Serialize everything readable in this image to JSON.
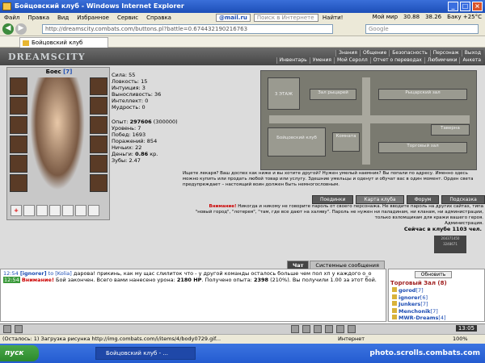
{
  "window": {
    "title": "Бойцовский клуб - Windows Internet Explorer"
  },
  "menu": {
    "items": [
      "Файл",
      "Правка",
      "Вид",
      "Избранное",
      "Сервис",
      "Справка"
    ],
    "mailru": "@mail.ru",
    "search_placeholder": "Поиск в Интернете",
    "find": "Найти!",
    "moi_mir": "Мой мир",
    "stock1": "30.88",
    "stock2": "38.26",
    "weather": "Баку +25°C"
  },
  "address": {
    "url": "http://dreamscity.combats.com/buttons.pl?battle=0.674432190216763",
    "search_placeholder": "Google"
  },
  "tab": {
    "label": "Бойцовский клуб"
  },
  "game": {
    "logo": "DREAMSCITY",
    "nav_top": [
      "Знания",
      "Общение",
      "Безопасность",
      "Персонаж",
      "Выход"
    ],
    "nav_bottom": [
      "Инвентарь",
      "Умения",
      "Мой Серолл",
      "Отчет о переводах",
      "Любимчики",
      "Анкета"
    ],
    "char": {
      "name": "Боес",
      "level": "[7]"
    },
    "stats": [
      {
        "label": "Сила:",
        "value": "55"
      },
      {
        "label": "Ловкость:",
        "value": "15"
      },
      {
        "label": "Интуиция:",
        "value": "3"
      },
      {
        "label": "Выносливость:",
        "value": "36"
      },
      {
        "label": "Интеллект:",
        "value": "0"
      },
      {
        "label": "Мудрость:",
        "value": "0"
      }
    ],
    "exp": {
      "label": "Опыт:",
      "value": "297606",
      "extra": "(300000)"
    },
    "level": {
      "label": "Уровень:",
      "value": "7"
    },
    "wins": {
      "label": "Побед:",
      "value": "1693"
    },
    "losses": {
      "label": "Поражений:",
      "value": "854"
    },
    "draws": {
      "label": "Ничьих:",
      "value": "22"
    },
    "money": {
      "label": "Деньги:",
      "value": "0.86",
      "unit": "кр."
    },
    "teeth": {
      "label": "Зубы:",
      "value": "2.47"
    },
    "map": {
      "floor": "3 ЭТАЖ",
      "halls": [
        "Зал рыцарей",
        "Рыцарский зал",
        "Торговый зал",
        "Комната",
        "Бойцовский клуб",
        "Таверна"
      ]
    },
    "msg": "Ищете лекаря? Ваш доспех как ниже и вы хотите другой? Нужен умелый наемник? Вы попали по адресу. Именно здесь можно купить или продать любой товар или услугу. Здешние умельцы и оденут и обучат вас в один момент. Орден света предупреждает – настоящий воин должен быть немногословным.",
    "buttons": [
      "Поединки",
      "Карта клуба",
      "Форум",
      "Подсказка"
    ],
    "warning": {
      "lead": "Внимание!",
      "text": "Никогда и никому не говорите пароль от своего персонажа. Не вводите пароль на других сайтах, типа \"новый город\", \"лотерея\", \"там, где все дают на халяву\". Пароль не нужен ни паладинам, ни кланам, ни администрации, только взломщикам для кражи вашего героя.",
      "sign": "Администрация."
    },
    "online": "Сейчас в клубе 1103 чел.",
    "counter": "264371450 \n 3248671",
    "chat_tabs": [
      "Чат",
      "Системные сообщения"
    ],
    "chat": {
      "line1": {
        "time": "12:54",
        "nick": "[ignorer]",
        "to": "to [Kolia]",
        "text": "дарова! прикинь, как му щас слилиток что - у другой команды осталось больше чем пол хп у каждого о_о"
      },
      "line2": {
        "time": "12:54",
        "lead": "Внимание!",
        "text": "Бой закончен. Всего вами нанесено урона:",
        "dmg": "2180 HP",
        "text2": ". Получено опыта:",
        "exp": "2398",
        "text3": "(210%). Вы получили",
        "money": "1.00",
        "text4": "за этот бой."
      }
    },
    "users": {
      "refresh": "Обновить",
      "room": "Торговый Зал (8)",
      "list": [
        {
          "name": "gorod",
          "lvl": "[7]"
        },
        {
          "name": "ignorer",
          "lvl": "[6]"
        },
        {
          "name": "Junkers",
          "lvl": "[7]"
        },
        {
          "name": "Menchonik",
          "lvl": "[7]"
        },
        {
          "name": "MWR-Dreams",
          "lvl": "[4]"
        }
      ]
    },
    "clock": "13:05"
  },
  "statusbar": {
    "text": "(Осталось: 1) Загрузка рисунка http://img.combats.com/i/items/4/body0729.gif...",
    "zone": "Интернет",
    "zoom": "100%"
  },
  "taskbar": {
    "start": "пуск",
    "task": "Бойцовский клуб - ...",
    "watermark": "photo.scrolls.combats.com"
  }
}
